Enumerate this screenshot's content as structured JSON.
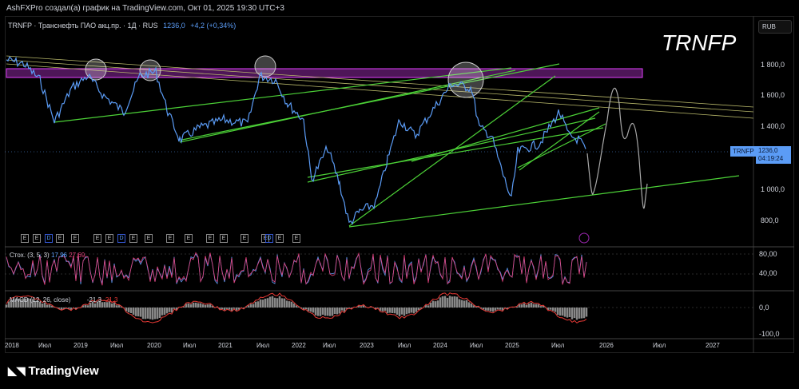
{
  "credit": "AshFXPro создал(а) график на TradingView.com, Окт 01, 2025 19:30 UTC+3",
  "legend": {
    "symbol": "TRNFP · Транснефть ПАО акц.пр. · 1Д · RUS",
    "price": "1236,0",
    "change": "+4,2 (+0,34%)"
  },
  "watermark": "TRNFP",
  "currency": "RUB",
  "price_axis": [
    "1 800,0",
    "1 600,0",
    "1 400,0",
    "1 000,0",
    "800,0"
  ],
  "price_tag": {
    "symbol": "TRNFP",
    "price": "1236,0",
    "countdown": "04:19:24"
  },
  "stoch": {
    "label": "Стох. (3, 5, 3)",
    "k": "17,96",
    "d": "27,69",
    "axis": [
      "80,00",
      "40,00"
    ]
  },
  "macd": {
    "label": "MACD (12, 26, close)",
    "v1": "-21,3",
    "v2": "-21,3",
    "axis": [
      "0,0",
      "-100,0"
    ]
  },
  "time_axis": [
    "2018",
    "Июл",
    "2019",
    "Июл",
    "2020",
    "Июл",
    "2021",
    "Июл",
    "2022",
    "Июл",
    "2023",
    "Июл",
    "2024",
    "Июл",
    "2025",
    "Июл",
    "2026",
    "Июл",
    "2027"
  ],
  "events": [
    "E",
    "E",
    "D",
    "E",
    "E",
    "E",
    "E",
    "D",
    "E",
    "E",
    "E",
    "E",
    "E",
    "E",
    "E",
    "E",
    "D",
    "E",
    "E"
  ],
  "footer": "TradingView",
  "colors": {
    "price": "#5b9cf6",
    "trend": "#4cd137",
    "zone": "#e040fb",
    "stochK": "#5b9cf6",
    "stochD": "#e0407a",
    "macd": "#e53935"
  }
}
